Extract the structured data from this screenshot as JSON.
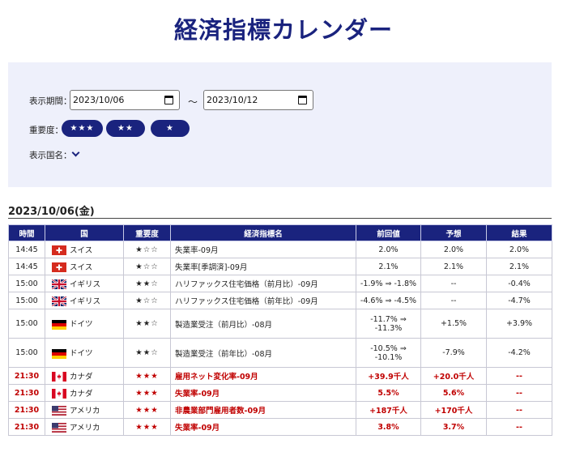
{
  "page": {
    "title": "経済指標カレンダー"
  },
  "filters": {
    "period_label": "表示期間：",
    "start_date": "2023/10/06",
    "tilde": "～",
    "end_date": "2023/10/12",
    "importance_label": "重要度：",
    "importance_buttons": [
      "★★★",
      "★★",
      "★"
    ],
    "country_label": "表示国名："
  },
  "table": {
    "date_header": "2023/10/06(金)",
    "columns": [
      "時間",
      "国",
      "重要度",
      "経済指標名",
      "前回値",
      "予想",
      "結果"
    ],
    "rows": [
      {
        "time": "14:45",
        "flag": "switzerland-flag",
        "country": "スイス",
        "importance": "★☆☆",
        "indicator": "失業率-09月",
        "previous": "2.0%",
        "forecast": "2.0%",
        "result": "2.0%",
        "highlight": false
      },
      {
        "time": "14:45",
        "flag": "switzerland-flag",
        "country": "スイス",
        "importance": "★☆☆",
        "indicator": "失業率[季調済]-09月",
        "previous": "2.1%",
        "forecast": "2.1%",
        "result": "2.1%",
        "highlight": false
      },
      {
        "time": "15:00",
        "flag": "uk-flag",
        "country": "イギリス",
        "importance": "★★☆",
        "indicator": "ハリファックス住宅価格（前月比）-09月",
        "previous": "-1.9% ⇒ -1.8%",
        "forecast": "--",
        "result": "-0.4%",
        "highlight": false
      },
      {
        "time": "15:00",
        "flag": "uk-flag",
        "country": "イギリス",
        "importance": "★☆☆",
        "indicator": "ハリファックス住宅価格（前年比）-09月",
        "previous": "-4.6% ⇒ -4.5%",
        "forecast": "--",
        "result": "-4.7%",
        "highlight": false
      },
      {
        "time": "15:00",
        "flag": "germany-flag",
        "country": "ドイツ",
        "importance": "★★☆",
        "indicator": "製造業受注（前月比）-08月",
        "previous_line1": "-11.7% ⇒",
        "previous_line2": "-11.3%",
        "forecast": "+1.5%",
        "result": "+3.9%",
        "highlight": false
      },
      {
        "time": "15:00",
        "flag": "germany-flag",
        "country": "ドイツ",
        "importance": "★★☆",
        "indicator": "製造業受注（前年比）-08月",
        "previous_line1": "-10.5% ⇒",
        "previous_line2": "-10.1%",
        "forecast": "-7.9%",
        "result": "-4.2%",
        "highlight": false
      },
      {
        "time": "21:30",
        "flag": "canada-flag",
        "country": "カナダ",
        "importance": "★★★",
        "indicator": "雇用ネット変化率-09月",
        "previous": "+39.9千人",
        "forecast": "+20.0千人",
        "result": "--",
        "highlight": true
      },
      {
        "time": "21:30",
        "flag": "canada-flag",
        "country": "カナダ",
        "importance": "★★★",
        "indicator": "失業率-09月",
        "previous": "5.5%",
        "forecast": "5.6%",
        "result": "--",
        "highlight": true
      },
      {
        "time": "21:30",
        "flag": "usa-flag",
        "country": "アメリカ",
        "importance": "★★★",
        "indicator": "非農業部門雇用者数-09月",
        "previous": "+187千人",
        "forecast": "+170千人",
        "result": "--",
        "highlight": true
      },
      {
        "time": "21:30",
        "flag": "usa-flag",
        "country": "アメリカ",
        "importance": "★★★",
        "indicator": "失業率-09月",
        "previous": "3.8%",
        "forecast": "3.7%",
        "result": "--",
        "highlight": true
      }
    ]
  },
  "colors": {
    "accent": "#1a237e",
    "highlight_text": "#c00000",
    "panel_bg": "#eef0fb"
  }
}
